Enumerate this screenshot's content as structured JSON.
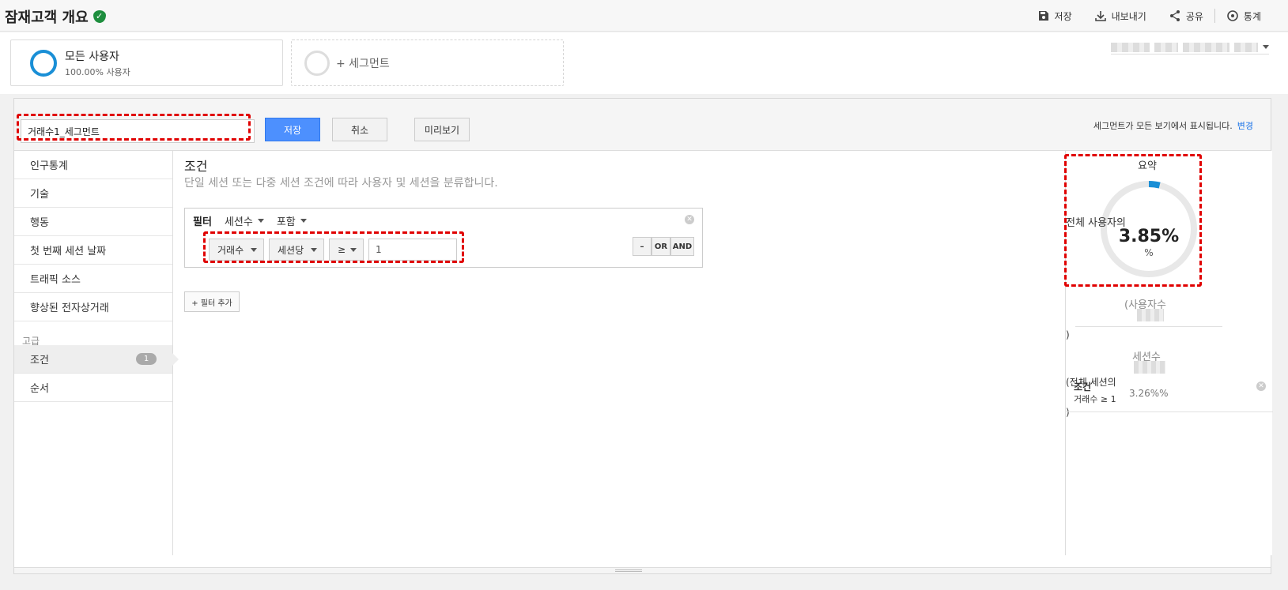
{
  "header": {
    "title": "잠재고객 개요",
    "actions": {
      "save": "저장",
      "export": "내보내기",
      "share": "공유",
      "insights": "통계"
    }
  },
  "segments": {
    "all_users": {
      "name": "모든 사용자",
      "pct": "100.00% 사용자"
    },
    "add": "+ 세그먼트"
  },
  "editor": {
    "segment_name": "거래수1_세그먼트",
    "buttons": {
      "save": "저장",
      "cancel": "취소",
      "preview": "미리보기"
    },
    "visibility_text": "세그먼트가 모든 보기에서 표시됩니다.",
    "visibility_link": "변경"
  },
  "nav": {
    "items": [
      "인구통계",
      "기술",
      "행동",
      "첫 번째 세션 날짜",
      "트래픽 소스",
      "향상된 전자상거래"
    ],
    "advanced_heading": "고급",
    "advanced": [
      {
        "label": "조건",
        "badge": "1"
      },
      {
        "label": "순서"
      }
    ]
  },
  "conditions": {
    "title": "조건",
    "description": "단일 세션 또는 다중 세션 조건에 따라 사용자 및 세션을 분류합니다.",
    "filter": {
      "label": "필터",
      "scope": "세션수",
      "mode": "포함",
      "metric": "거래수",
      "per": "세션당",
      "operator": "≥",
      "value": "1",
      "logic": {
        "minus": "–",
        "or": "OR",
        "and": "AND"
      }
    },
    "add_filter": "+ 필터 추가"
  },
  "summary": {
    "title": "요약",
    "users_label": "전체 사용자의",
    "users_pct": 3.85,
    "users_pct_text": "3.85%",
    "unit": "%",
    "users_count_label": "(사용자수",
    "paren_close": ")",
    "sessions_label": "세션수",
    "sessions_pct_label": "(전체 세션의",
    "sessions_pct_text": "3.26%%",
    "condition_title": "조건",
    "condition_text": "거래수 ≥ 1",
    "accent_color": "#1a8fd6"
  }
}
